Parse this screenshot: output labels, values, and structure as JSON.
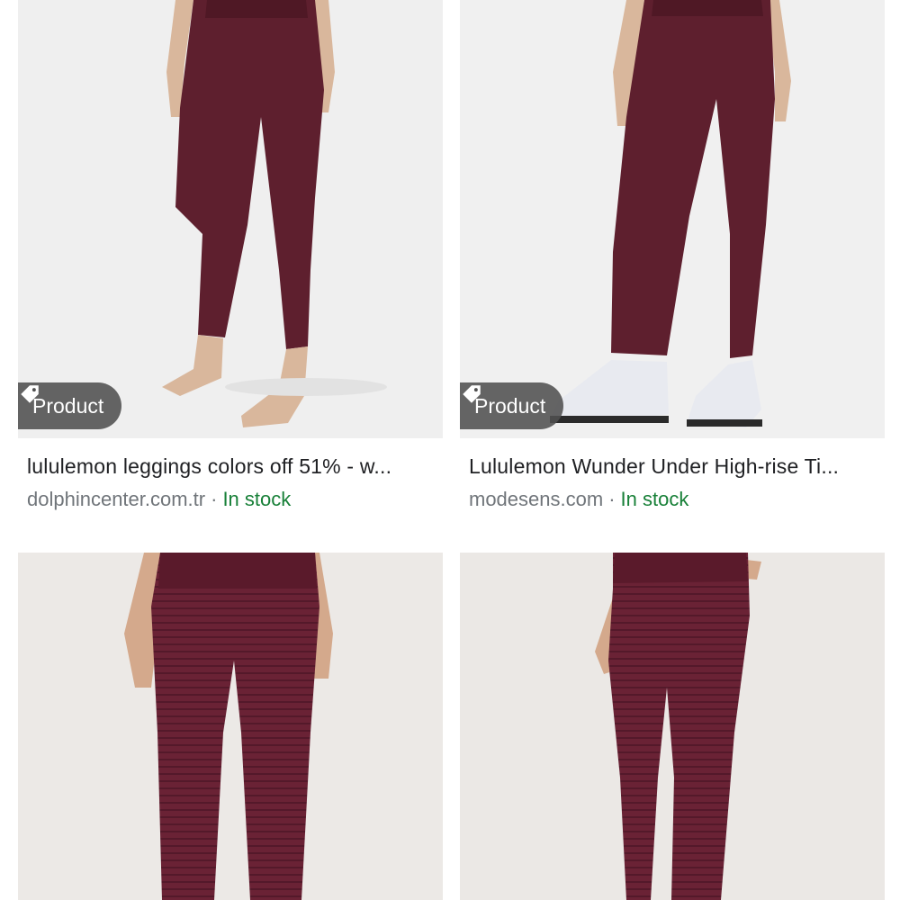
{
  "results": [
    {
      "badge": "Product",
      "title": "lululemon leggings colors off 51% - w...",
      "source": "dolphincenter.com.tr",
      "separator": "·",
      "stock": "In stock"
    },
    {
      "badge": "Product",
      "title": "Lululemon Wunder Under High-rise Ti...",
      "source": "modesens.com",
      "separator": "·",
      "stock": "In stock"
    },
    {
      "badge": "",
      "title": "",
      "source": "",
      "separator": "",
      "stock": ""
    },
    {
      "badge": "",
      "title": "",
      "source": "",
      "separator": "",
      "stock": ""
    }
  ],
  "icons": {
    "badge_icon": "tag-icon"
  },
  "colors": {
    "legging": "#5e1f2e",
    "stock_green": "#188038",
    "source_gray": "#70757a",
    "title_text": "#202124",
    "badge_bg": "#505050"
  }
}
